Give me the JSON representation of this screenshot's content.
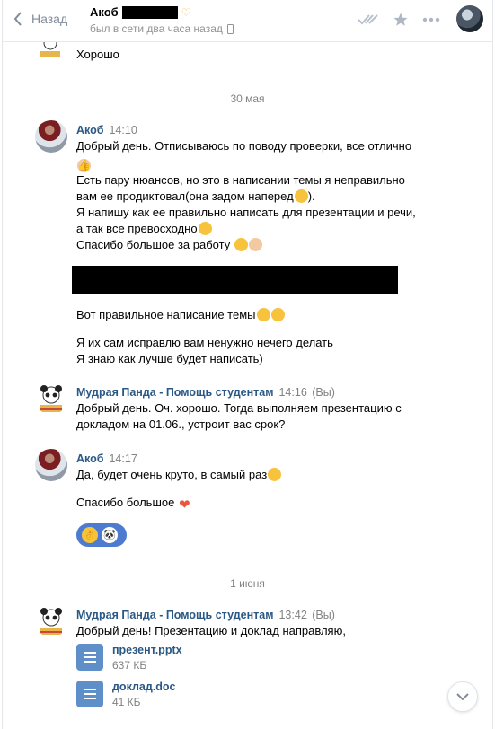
{
  "header": {
    "back_label": "Назад",
    "contact_name": "Акоб",
    "status": "был в сети два часа назад"
  },
  "messages": {
    "prev_text": "Хорошо",
    "date1": "30 мая",
    "akob1": {
      "author": "Акоб",
      "time": "14:10",
      "lines": [
        "Добрый день. Отписываюсь по поводу проверки, все отлично",
        "Есть пару нюансов, но это в написании темы я неправильно",
        "вам ее продиктовал(она задом наперед",
        ").",
        "Я напишу как ее правильно написать для презентации и речи,",
        "а так все превосходно",
        "Спасибо большое за работу"
      ],
      "line2": "Вот правильное написание темы",
      "line3": "Я их сам исправлю вам ненужно нечего делать",
      "line4": "Я знаю как лучше будет написать)"
    },
    "panda1": {
      "author": "Мудрая Панда - Помощь студентам",
      "time": "14:16",
      "you": "(Вы)",
      "line_a": "Добрый день. Оч. хорошо. Тогда выполняем презентацию с",
      "line_b": "докладом на 01.06., устроит вас срок?"
    },
    "akob2": {
      "author": "Акоб",
      "time": "14:17",
      "line_a": "Да, будет очень круто, в самый раз",
      "line_b": "Спасибо большое"
    },
    "date2": "1 июня",
    "panda2": {
      "author": "Мудрая Панда - Помощь студентам",
      "time": "13:42",
      "you": "(Вы)",
      "text": "Добрый день! Презентацию и доклад направляю,",
      "files": [
        {
          "name": "презент.pptx",
          "size": "637 КБ"
        },
        {
          "name": "доклад.doc",
          "size": "41 КБ"
        }
      ]
    }
  },
  "icons": {
    "back": "chevron-left-icon",
    "read": "double-check-icon",
    "star": "star-icon",
    "more": "more-icon",
    "scroll": "chevron-down-icon"
  }
}
